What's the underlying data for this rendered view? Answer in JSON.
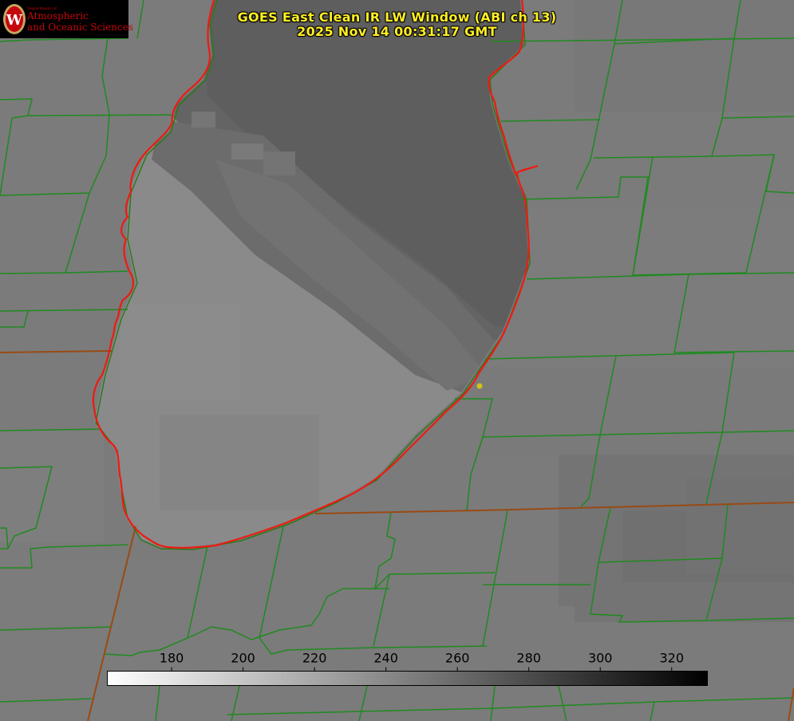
{
  "title": {
    "line1": "GOES East Clean IR LW Window (ABI ch 13)",
    "line2": "2025 Nov 14 00:31:17 GMT"
  },
  "logo": {
    "department": "Department of",
    "line1": "Atmospheric",
    "line2": "and Oceanic Sciences",
    "icon": "uw-crest-icon"
  },
  "colorbar": {
    "min": 162,
    "max": 330,
    "ticks": [
      180,
      200,
      220,
      240,
      260,
      280,
      300,
      320
    ],
    "scale": "white-to-black",
    "icon": "temperature-colorbar"
  },
  "colors": {
    "background": "#7a7a7a",
    "county_lines": "#1f8a1f",
    "coastline": "#ee1a12",
    "title": "#ffee22",
    "marker": "#d6c21a"
  }
}
